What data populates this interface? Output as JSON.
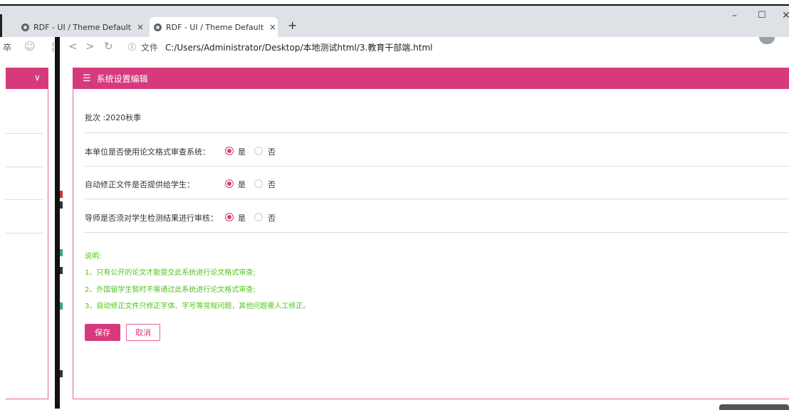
{
  "browser": {
    "tabs": [
      {
        "title": "RDF - UI / Theme Default",
        "close": "×"
      },
      {
        "title": "RDF - UI / Theme Default",
        "close": "×"
      }
    ],
    "new_tab": "+",
    "window": {
      "minimize": "–",
      "maximize": "☐",
      "close": "✕"
    },
    "address": {
      "info_icon": "ⓘ",
      "label": "文件",
      "url": "C:/Users/Administrator/Desktop/本地测试html/3.教育干部端.html"
    }
  },
  "form": {
    "header_title": "系统设置编辑",
    "batch": "批次 :2020秋季",
    "questions": [
      {
        "label": "本单位是否使用论文格式审查系统：",
        "yes": "是",
        "no": "否",
        "selected": "是"
      },
      {
        "label": "自动修正文件是否提供给学生：",
        "yes": "是",
        "no": "否",
        "selected": "是"
      },
      {
        "label": "导师是否须对学生检测结果进行审核：",
        "yes": "是",
        "no": "否",
        "selected": "是"
      }
    ],
    "notes_title": "说明:",
    "notes": [
      "1、只有公开的论文才能提交此系统进行论文格式审查;",
      "2、外国留学生暂时不需通过此系统进行论文格式审查;",
      "3、自动修正文件只修正字体、字号等常规问题，其他问题需人工修正。"
    ],
    "save_label": "保存",
    "cancel_label": "取消"
  },
  "colors": {
    "accent": "#d63a7c",
    "note": "#52c41a"
  }
}
